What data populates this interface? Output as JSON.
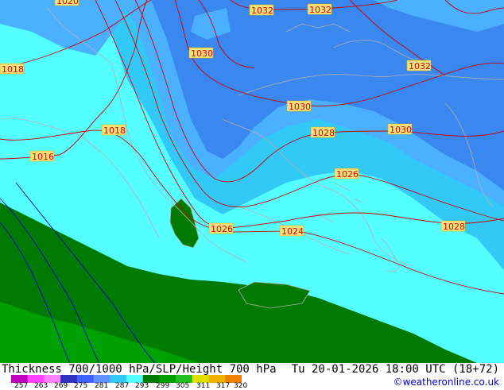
{
  "map": {
    "isobar_labels": [
      "1020",
      "1032",
      "1032",
      "1030",
      "1032",
      "1018",
      "1030",
      "1018",
      "1028",
      "1030",
      "1016",
      "1026",
      "1026",
      "1024",
      "1028"
    ],
    "credit": "©weatheronline.co.uk",
    "colors": {
      "deep_blue": "#3a87ef",
      "mid_blue": "#4ab0ff",
      "light_blue": "#33c9f7",
      "cyan": "#55ffff",
      "dark_green": "#007a00",
      "green": "#00a000",
      "isobar": "#d00000",
      "coast": "#b0b0b0",
      "thickness_line": "#0000cc"
    }
  },
  "footer": {
    "title": "Thickness 700/1000 hPa/SLP/Height 700 hPa",
    "time": "Tu 20-01-2026 18:00 UTC (18+72)",
    "credit": "©weatheronline.co.uk"
  },
  "colorbar": {
    "ticks": [
      "257",
      "263",
      "269",
      "275",
      "281",
      "287",
      "293",
      "299",
      "305",
      "311",
      "317",
      "320"
    ],
    "colors": [
      "#c000c0",
      "#ff40ff",
      "#ff80ff",
      "#3030c0",
      "#4060ff",
      "#6090ff",
      "#33c9f7",
      "#55ffff",
      "#007a00",
      "#00a000",
      "#20c020",
      "#e0e000",
      "#f0b000",
      "#f08000"
    ]
  }
}
